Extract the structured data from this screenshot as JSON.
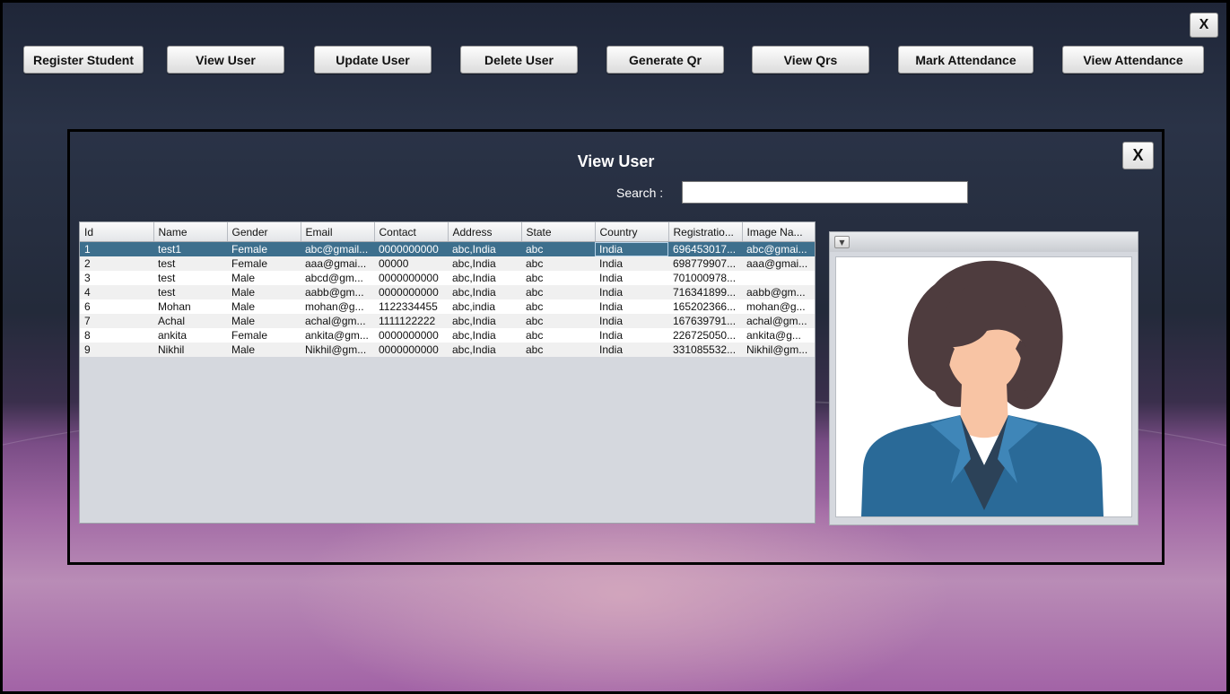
{
  "window": {
    "close_label": "X"
  },
  "nav": {
    "buttons": [
      "Register Student",
      "View User",
      "Update User",
      "Delete User",
      "Generate Qr",
      "View Qrs",
      "Mark Attendance",
      "View Attendance"
    ]
  },
  "dialog": {
    "title": "View User",
    "close_label": "X",
    "search_label": "Search :",
    "search_value": ""
  },
  "table": {
    "columns": [
      "Id",
      "Name",
      "Gender",
      "Email",
      "Contact",
      "Address",
      "State",
      "Country",
      "Registratio...",
      "Image Na..."
    ],
    "rows": [
      [
        "1",
        "test1",
        "Female",
        "abc@gmail...",
        "0000000000",
        "abc,India",
        "abc",
        "India",
        "696453017...",
        "abc@gmai..."
      ],
      [
        "2",
        "test",
        "Female",
        "aaa@gmai...",
        "00000",
        "abc,India",
        "abc",
        "India",
        "698779907...",
        "aaa@gmai..."
      ],
      [
        "3",
        "test",
        "Male",
        "abcd@gm...",
        "0000000000",
        "abc,India",
        "abc",
        "India",
        "701000978...",
        ""
      ],
      [
        "4",
        "test",
        "Male",
        "aabb@gm...",
        "0000000000",
        "abc,India",
        "abc",
        "India",
        "716341899...",
        "aabb@gm..."
      ],
      [
        "6",
        "Mohan",
        "Male",
        "mohan@g...",
        "1122334455",
        "abc,india",
        "abc",
        "India",
        "165202366...",
        "mohan@g..."
      ],
      [
        "7",
        "Achal",
        "Male",
        "achal@gm...",
        "1111122222",
        "abc,India",
        "abc",
        "India",
        "167639791...",
        "achal@gm..."
      ],
      [
        "8",
        "ankita",
        "Female",
        "ankita@gm...",
        "0000000000",
        "abc,India",
        "abc",
        "India",
        "226725050...",
        "ankita@g..."
      ],
      [
        "9",
        "Nikhil",
        "Male",
        "Nikhil@gm...",
        "0000000000",
        "abc,India",
        "abc",
        "India",
        "331085532...",
        "Nikhil@gm..."
      ]
    ],
    "selected_row": 0
  },
  "image_panel": {
    "dropdown_icon": "triangle-down-icon",
    "avatar": "female-avatar-illustration"
  },
  "colors": {
    "selected_row": "#3d6f8d",
    "hair": "#4e3c3e",
    "skin": "#f8c4a4",
    "jacket": "#2a6a98"
  }
}
